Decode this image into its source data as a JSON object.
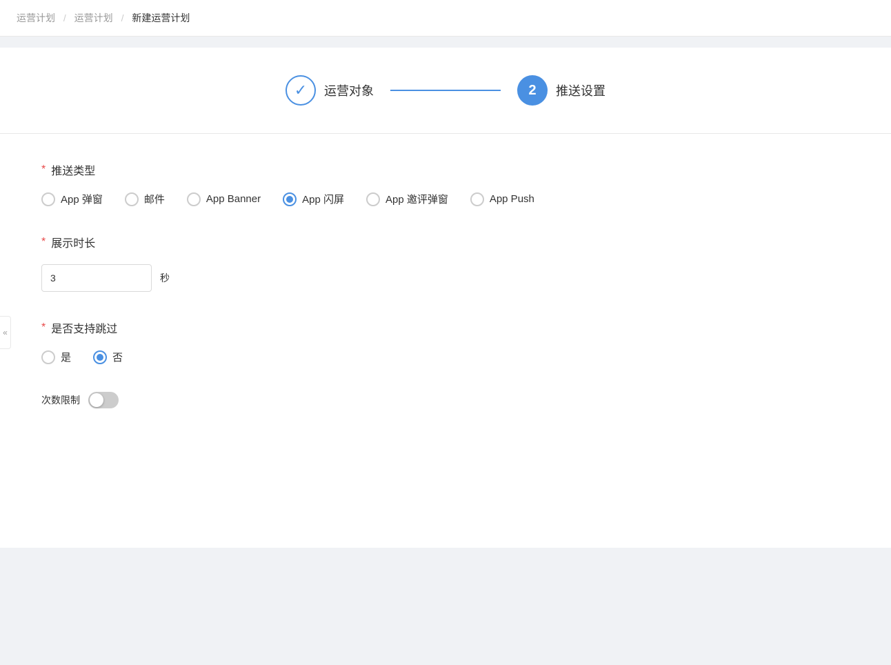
{
  "breadcrumb": {
    "items": [
      "运营计划",
      "运营计划",
      "新建运营计划"
    ],
    "separators": [
      "/",
      "/"
    ]
  },
  "steps": [
    {
      "id": "step1",
      "label": "运营对象",
      "status": "done",
      "icon": "✓"
    },
    {
      "id": "step2",
      "label": "推送设置",
      "status": "active",
      "number": "2"
    }
  ],
  "connector_color": "#4a90e2",
  "form": {
    "push_type": {
      "label": "推送类型",
      "required": true,
      "options": [
        {
          "id": "app_popup",
          "label": "App 弹窗",
          "selected": false
        },
        {
          "id": "email",
          "label": "邮件",
          "selected": false
        },
        {
          "id": "app_banner",
          "label": "App Banner",
          "selected": false
        },
        {
          "id": "app_flash",
          "label": "App 闪屏",
          "selected": true
        },
        {
          "id": "app_review",
          "label": "App 邀评弹窗",
          "selected": false
        },
        {
          "id": "app_push",
          "label": "App Push",
          "selected": false
        }
      ]
    },
    "display_duration": {
      "label": "展示时长",
      "required": true,
      "value": "3",
      "placeholder": "",
      "suffix": "秒"
    },
    "skip_support": {
      "label": "是否支持跳过",
      "required": true,
      "options": [
        {
          "id": "yes",
          "label": "是",
          "selected": false
        },
        {
          "id": "no",
          "label": "否",
          "selected": true
        }
      ]
    },
    "count_limit": {
      "label": "次数限制",
      "enabled": false
    }
  },
  "collapse_icon": "«",
  "required_star": "*",
  "accent_color": "#4a90e2"
}
